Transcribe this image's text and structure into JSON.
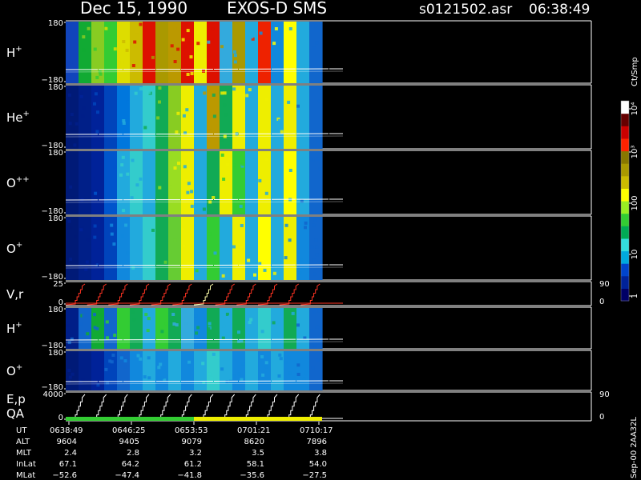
{
  "header": {
    "date": "Dec 15, 1990",
    "instrument": "EXOS-D SMS",
    "file": "s0121502.asr",
    "time": "06:38:49"
  },
  "colorbar": {
    "unit": "Ct/Smp",
    "tick_labels": [
      "1",
      "10",
      "100",
      "10³",
      "10⁴"
    ],
    "colors": [
      "#000066",
      "#002299",
      "#0044cc",
      "#00aadd",
      "#33dddd",
      "#00aa55",
      "#33cc33",
      "#99ee22",
      "#ffff00",
      "#ccbb00",
      "#aa9900",
      "#887700",
      "#ff2200",
      "#cc0000",
      "#660000",
      "#ffffff"
    ]
  },
  "footer": {
    "version": "Sep-00 2AA32L",
    "row_labels": [
      "UT",
      "ALT",
      "MLT",
      "InLat",
      "MLat"
    ],
    "columns": [
      {
        "UT": "0638:49",
        "ALT": "9604",
        "MLT": "2.4",
        "InLat": "67.1",
        "MLat": "−52.6"
      },
      {
        "UT": "0646:25",
        "ALT": "9405",
        "MLT": "2.8",
        "InLat": "64.2",
        "MLat": "−47.4"
      },
      {
        "UT": "0653:53",
        "ALT": "9079",
        "MLT": "3.2",
        "InLat": "61.2",
        "MLat": "−41.8"
      },
      {
        "UT": "0701:21",
        "ALT": "8620",
        "MLT": "3.5",
        "InLat": "58.1",
        "MLat": "−35.6"
      },
      {
        "UT": "0710:17",
        "ALT": "7896",
        "MLT": "3.8",
        "InLat": "54.0",
        "MLat": "−27.5"
      }
    ]
  },
  "chart_data": [
    {
      "type": "heatmap",
      "name": "H+",
      "label_base": "H",
      "label_sup": "+",
      "y_top_label": "180",
      "y_bottom_label": "−180",
      "ylim": [
        -180,
        180
      ],
      "bands": [
        {
          "color": "#1144bb",
          "pattern": "mix"
        },
        {
          "color": "#11aa33"
        },
        {
          "color": "#88cc22"
        },
        {
          "color": "#33cc33"
        },
        {
          "color": "#dddd00"
        },
        {
          "color": "#ccbb00"
        },
        {
          "color": "#dd1100"
        },
        {
          "color": "#aa9900"
        },
        {
          "color": "#bb9900"
        },
        {
          "color": "#dd1100"
        },
        {
          "color": "#eeee00"
        },
        {
          "color": "#dd1100"
        },
        {
          "color": "#33aadd"
        },
        {
          "color": "#aa9900"
        },
        {
          "color": "#22aadd"
        },
        {
          "color": "#ee2200"
        },
        {
          "color": "#1188dd"
        },
        {
          "color": "#ffff00"
        },
        {
          "color": "#22aadd"
        },
        {
          "color": "#1166cc"
        }
      ]
    },
    {
      "type": "heatmap",
      "name": "He+",
      "label_base": "He",
      "label_sup": "+",
      "y_top_label": "180",
      "y_bottom_label": "−180",
      "ylim": [
        -180,
        180
      ],
      "bands": [
        {
          "color": "#001a77"
        },
        {
          "color": "#001f88"
        },
        {
          "color": "#002299"
        },
        {
          "color": "#0044bb"
        },
        {
          "color": "#0077dd"
        },
        {
          "color": "#22aadd"
        },
        {
          "color": "#33cccc"
        },
        {
          "color": "#11aa55"
        },
        {
          "color": "#88cc22"
        },
        {
          "color": "#eeee00"
        },
        {
          "color": "#22aadd"
        },
        {
          "color": "#bb9900"
        },
        {
          "color": "#11aa55"
        },
        {
          "color": "#eeee00"
        },
        {
          "color": "#22aadd"
        },
        {
          "color": "#eeee00"
        },
        {
          "color": "#22aadd"
        },
        {
          "color": "#eeee00"
        },
        {
          "color": "#22aadd"
        },
        {
          "color": "#1166cc"
        }
      ]
    },
    {
      "type": "heatmap",
      "name": "O++",
      "label_base": "O",
      "label_sup": "++",
      "y_top_label": "180",
      "y_bottom_label": "−180",
      "ylim": [
        -180,
        180
      ],
      "bands": [
        {
          "color": "#001a77"
        },
        {
          "color": "#001f88"
        },
        {
          "color": "#002299"
        },
        {
          "color": "#0055cc"
        },
        {
          "color": "#22aadd"
        },
        {
          "color": "#33cccc"
        },
        {
          "color": "#22aadd"
        },
        {
          "color": "#11aa55"
        },
        {
          "color": "#99dd22"
        },
        {
          "color": "#eeee00"
        },
        {
          "color": "#22aadd"
        },
        {
          "color": "#11aa55"
        },
        {
          "color": "#eeee00"
        },
        {
          "color": "#33cc33"
        },
        {
          "color": "#22aadd"
        },
        {
          "color": "#eeee00"
        },
        {
          "color": "#22aadd"
        },
        {
          "color": "#ffff00"
        },
        {
          "color": "#22aadd"
        },
        {
          "color": "#1166cc"
        }
      ]
    },
    {
      "type": "heatmap",
      "name": "O+",
      "label_base": "O",
      "label_sup": "+",
      "y_top_label": "180",
      "y_bottom_label": "−180",
      "ylim": [
        -180,
        180
      ],
      "bands": [
        {
          "color": "#001a77"
        },
        {
          "color": "#001f88"
        },
        {
          "color": "#002299"
        },
        {
          "color": "#0044bb"
        },
        {
          "color": "#1188dd"
        },
        {
          "color": "#22aadd"
        },
        {
          "color": "#33cccc"
        },
        {
          "color": "#11aa55"
        },
        {
          "color": "#66cc33"
        },
        {
          "color": "#eeee00"
        },
        {
          "color": "#22aadd"
        },
        {
          "color": "#33cc33"
        },
        {
          "color": "#22aadd"
        },
        {
          "color": "#eeee00"
        },
        {
          "color": "#22aadd"
        },
        {
          "color": "#ffff00"
        },
        {
          "color": "#22aadd"
        },
        {
          "color": "#eeee00"
        },
        {
          "color": "#1188dd"
        },
        {
          "color": "#1166cc"
        }
      ]
    },
    {
      "type": "line",
      "name": "V,r",
      "label_base": "V,r",
      "y_top_label": "25",
      "y_bottom_label": "0",
      "right_top_label": "90",
      "right_bottom_label": "0",
      "ylim": [
        0,
        25
      ],
      "steps": 12,
      "highlight_step": 6
    },
    {
      "type": "heatmap",
      "name": "H+ (lower)",
      "label_base": "H",
      "label_sup": "+",
      "y_top_label": "180",
      "y_bottom_label": "−180",
      "ylim": [
        -180,
        180
      ],
      "bands": [
        {
          "color": "#001f88"
        },
        {
          "color": "#1166cc"
        },
        {
          "color": "#11aa33"
        },
        {
          "color": "#1166cc"
        },
        {
          "color": "#33cc33"
        },
        {
          "color": "#11aa55"
        },
        {
          "color": "#22aadd"
        },
        {
          "color": "#33cc33"
        },
        {
          "color": "#11aa55"
        },
        {
          "color": "#33aadd"
        },
        {
          "color": "#1188dd"
        },
        {
          "color": "#11aa55"
        },
        {
          "color": "#22aadd"
        },
        {
          "color": "#11aa55"
        },
        {
          "color": "#22aadd"
        },
        {
          "color": "#33cccc"
        },
        {
          "color": "#22aadd"
        },
        {
          "color": "#11aa55"
        },
        {
          "color": "#22aadd"
        },
        {
          "color": "#1166cc"
        }
      ]
    },
    {
      "type": "heatmap",
      "name": "O+ (lower)",
      "label_base": "O",
      "label_sup": "+",
      "y_top_label": "180",
      "y_bottom_label": "−180",
      "ylim": [
        -180,
        180
      ],
      "bands": [
        {
          "color": "#001a77"
        },
        {
          "color": "#001f88"
        },
        {
          "color": "#002299"
        },
        {
          "color": "#0044bb"
        },
        {
          "color": "#1166cc"
        },
        {
          "color": "#1188dd"
        },
        {
          "color": "#22aadd"
        },
        {
          "color": "#1188dd"
        },
        {
          "color": "#22aadd"
        },
        {
          "color": "#1188dd"
        },
        {
          "color": "#22aadd"
        },
        {
          "color": "#33cccc"
        },
        {
          "color": "#22aadd"
        },
        {
          "color": "#1188dd"
        },
        {
          "color": "#22aadd"
        },
        {
          "color": "#1188dd"
        },
        {
          "color": "#22aadd"
        },
        {
          "color": "#1188dd"
        },
        {
          "color": "#1188dd"
        },
        {
          "color": "#1166cc"
        }
      ]
    },
    {
      "type": "line",
      "name": "E,p QA",
      "label_base": "E,p",
      "label_second": "QA",
      "y_top_label": "4000",
      "y_bottom_label": "0",
      "right_top_label": "90",
      "right_bottom_label": "0",
      "ylim": [
        0,
        4000
      ],
      "steps": 12,
      "qa_bar": [
        {
          "color": "#33cc33",
          "from": 0,
          "to": 0.5
        },
        {
          "color": "#eeee00",
          "from": 0.5,
          "to": 1
        }
      ]
    }
  ]
}
